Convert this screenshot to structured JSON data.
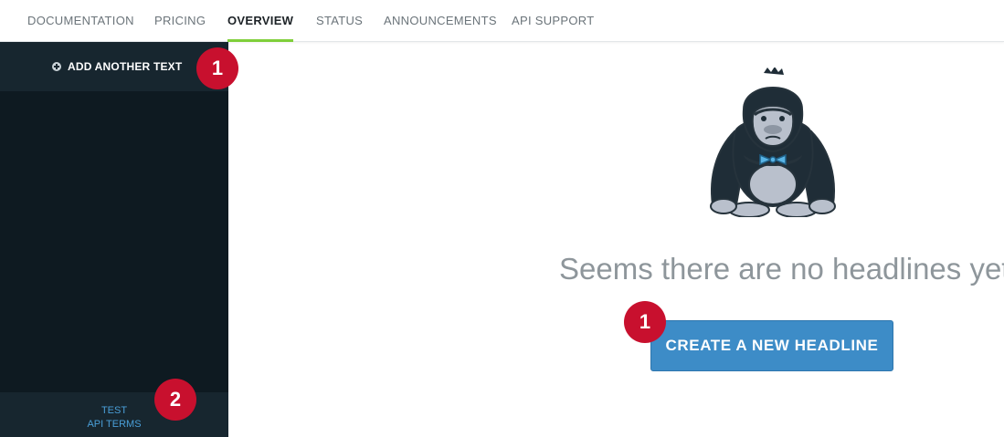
{
  "nav": {
    "tabs": [
      {
        "label": "DOCUMENTATION"
      },
      {
        "label": "PRICING"
      },
      {
        "label": "OVERVIEW",
        "active": true
      },
      {
        "label": "STATUS"
      },
      {
        "label": "ANNOUNCEMENTS"
      },
      {
        "label": "API SUPPORT"
      }
    ]
  },
  "sidebar": {
    "add_label": "ADD ANOTHER TEXT",
    "footer": {
      "test_label": "TEST",
      "terms_label": "API TERMS"
    }
  },
  "badges": {
    "sidebar_top": "1",
    "sidebar_bottom": "2",
    "create": "1"
  },
  "main": {
    "empty_message": "Seems there are no headlines yet.",
    "create_label": "CREATE A NEW HEADLINE",
    "illustration": "gorilla-mascot-icon"
  },
  "colors": {
    "sidebar_bg": "#0e1a21",
    "sidebar_panel": "#17262f",
    "active_underline": "#7fcf3a",
    "button": "#3d8cc7",
    "badge": "#c8102e",
    "link": "#4a9fd8"
  }
}
